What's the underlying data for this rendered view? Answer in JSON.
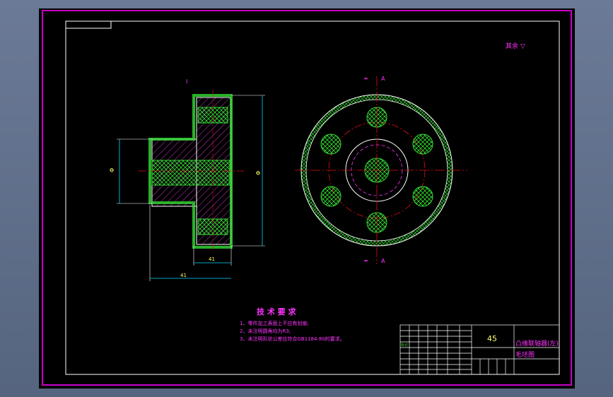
{
  "roughness_note": "其余 ▽",
  "dimensions": {
    "left_height": "Φ",
    "right_height": "Φ",
    "hub_width": "41",
    "total_width": "41",
    "tag_a": "I"
  },
  "tech_requirements": {
    "title": "技 术 要 求",
    "items": [
      "1、零件加工表面上不应有划痕;",
      "2、未注明圆角均为R3;",
      "3、未注明形状公差应符合GB1184-80的要求。"
    ]
  },
  "title_block": {
    "material": "45",
    "part_name_line1": "凸缘联轴器(左)",
    "part_name_line2": "毛坯图",
    "label_small": "标记"
  },
  "colors": {
    "frame_magenta": "#c800c8",
    "line_white": "#ffffff",
    "hatch_green": "#33dd33",
    "center_red": "#e01010",
    "dim_cyan": "#00d8ff",
    "text_magenta": "#ff33ff",
    "text_yellow": "#ffff66"
  }
}
